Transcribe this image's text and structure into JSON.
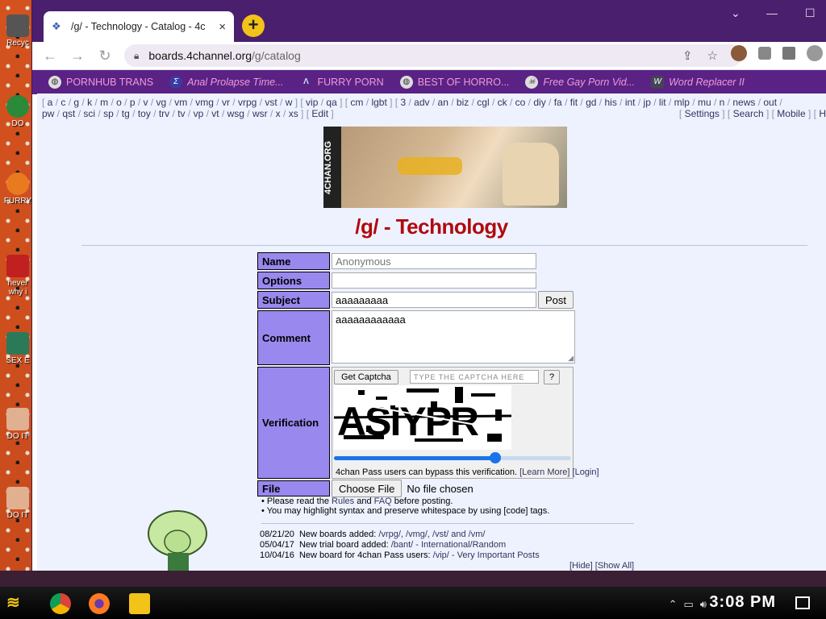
{
  "desktop": {
    "icons": [
      {
        "label": "Recyc",
        "color": "#555"
      },
      {
        "label": "DO",
        "color": "#2a8a3a"
      },
      {
        "label": "FURRY",
        "color": "#e87a20"
      },
      {
        "label": "never why i",
        "color": "#c02020"
      },
      {
        "label": "SEX E",
        "color": "#2a7a5a"
      },
      {
        "label": "DO IT",
        "color": "#e0b090"
      },
      {
        "label": "DO IT",
        "color": "#e0b090"
      }
    ]
  },
  "browser": {
    "tab": {
      "title": "/g/ - Technology - Catalog - 4c",
      "close": "×"
    },
    "newtab": "+",
    "url": {
      "host": "boards.4channel.org",
      "path": "/g/catalog"
    },
    "bookmarks": [
      {
        "label": "PORNHUB TRANS",
        "italic": false
      },
      {
        "label": "Anal Prolapse Time...",
        "italic": true
      },
      {
        "label": "FURRY PORN",
        "italic": false
      },
      {
        "label": "BEST OF HORRO...",
        "italic": false
      },
      {
        "label": "Free Gay Porn Vid...",
        "italic": true
      },
      {
        "label": "Word Replacer II",
        "italic": true
      }
    ]
  },
  "page": {
    "boardlist_line1": [
      "[",
      "a",
      "/",
      "c",
      "/",
      "g",
      "/",
      "k",
      "/",
      "m",
      "/",
      "o",
      "/",
      "p",
      "/",
      "v",
      "/",
      "vg",
      "/",
      "vm",
      "/",
      "vmg",
      "/",
      "vr",
      "/",
      "vrpg",
      "/",
      "vst",
      "/",
      "w",
      "] [",
      "vip",
      "/",
      "qa",
      "] [",
      "cm",
      "/",
      "lgbt",
      "] [",
      "3",
      "/",
      "adv",
      "/",
      "an",
      "/",
      "biz",
      "/",
      "cgl",
      "/",
      "ck",
      "/",
      "co",
      "/",
      "diy",
      "/",
      "fa",
      "/",
      "fit",
      "/",
      "gd",
      "/",
      "his",
      "/",
      "int",
      "/",
      "jp",
      "/",
      "lit",
      "/",
      "mlp",
      "/",
      "mu",
      "/",
      "n",
      "/",
      "news",
      "/",
      "out",
      "/"
    ],
    "boardlist_line2": [
      "pw",
      "/",
      "qst",
      "/",
      "sci",
      "/",
      "sp",
      "/",
      "tg",
      "/",
      "toy",
      "/",
      "trv",
      "/",
      "tv",
      "/",
      "vp",
      "/",
      "vt",
      "/",
      "wsg",
      "/",
      "wsr",
      "/",
      "x",
      "/",
      "xs",
      "] [",
      "Edit",
      "]"
    ],
    "boardlist_right": [
      "[",
      "Settings",
      "] [",
      "Search",
      "] [",
      "Mobile",
      "] [",
      "H"
    ],
    "banner_text": "4CHAN.ORG",
    "board_title": "/g/ - Technology",
    "form": {
      "name_label": "Name",
      "name_placeholder": "Anonymous",
      "options_label": "Options",
      "subject_label": "Subject",
      "subject_value": "aaaaaaaaa",
      "post_button": "Post",
      "comment_label": "Comment",
      "comment_value": "aaaaaaaaaaaa",
      "verification_label": "Verification",
      "get_captcha": "Get Captcha",
      "captcha_placeholder": "TYPE  THE  CAPTCHA  HERE",
      "captcha_help": "?",
      "captcha_text": "ASIYPR",
      "slider_fraction": 0.68,
      "pass_note": "4chan Pass users can bypass this verification.",
      "learn_more": "[Learn More]",
      "login": "[Login]",
      "file_label": "File",
      "choose_file": "Choose File",
      "no_file": "No file chosen"
    },
    "rules": [
      [
        "• Please read the ",
        "Rules",
        " and ",
        "FAQ",
        " before posting."
      ],
      [
        "• You may highlight syntax and preserve whitespace by using [code] tags."
      ]
    ],
    "news": [
      {
        "date": "08/21/20",
        "text": "New boards added: ",
        "link": "/vrpg/, /vmg/, /vst/ and /vm/"
      },
      {
        "date": "05/04/17",
        "text": "New trial board added: ",
        "link": "/bant/ - International/Random"
      },
      {
        "date": "10/04/16",
        "text": "New board for 4chan Pass users: ",
        "link": "/vip/ - Very Important Posts"
      }
    ],
    "hide_show": "[Hide] [Show All]"
  },
  "taskbar": {
    "clock": "3:08 PM"
  },
  "colors": {
    "title_red": "#af0a0f",
    "label_purple": "#9988ee",
    "bookmark_bar": "#5a2285",
    "bookmark_text": "#f09ad8"
  }
}
